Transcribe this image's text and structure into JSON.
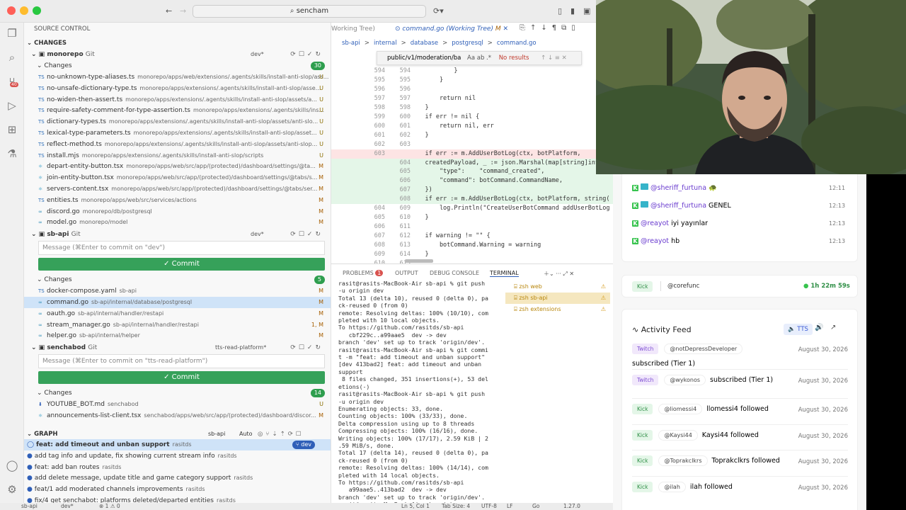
{
  "titlebar": {
    "search": "sencham"
  },
  "sidebar": {
    "header": "SOURCE CONTROL",
    "changes_title": "CHANGES",
    "repos": [
      {
        "name": "monorepo",
        "type": "Git",
        "branch": "dev*",
        "changes_label": "Changes",
        "count": "30",
        "files": [
          {
            "name": "no-unknown-type-aliases.ts",
            "path": "monorepo/apps/web/extensions/.agents/skills/install-anti-slop/ass...",
            "status": "U"
          },
          {
            "name": "no-unsafe-dictionary-type.ts",
            "path": "monorepo/apps/extensions/.agents/skills/install-anti-slop/asse...",
            "status": "U"
          },
          {
            "name": "no-widen-then-assert.ts",
            "path": "monorepo/apps/extensions/.agents/skills/install-anti-slop/assets/a...",
            "status": "U"
          },
          {
            "name": "require-safety-comment-for-type-assertion.ts",
            "path": "monorepo/apps/extensions/.agents/skills/ins...",
            "status": "U"
          },
          {
            "name": "dictionary-types.ts",
            "path": "monorepo/apps/extensions/.agents/skills/install-anti-slop/assets/anti-slo...",
            "status": "U"
          },
          {
            "name": "lexical-type-parameters.ts",
            "path": "monorepo/apps/extensions/.agents/skills/install-anti-slop/asset...",
            "status": "U"
          },
          {
            "name": "reflect-method.ts",
            "path": "monorepo/apps/extensions/.agents/skills/install-anti-slop/assets/anti-slop...",
            "status": "U"
          },
          {
            "name": "install.mjs",
            "path": "monorepo/apps/extensions/.agents/skills/install-anti-slop/scripts",
            "status": "U"
          },
          {
            "name": "depart-entity-button.tsx",
            "path": "monorepo/apps/web/src/app/(protected)/dashboard/settings/@ta...",
            "status": "M"
          },
          {
            "name": "join-entity-button.tsx",
            "path": "monorepo/apps/web/src/app/(protected)/dashboard/settings/@tabs/s...",
            "status": "M"
          },
          {
            "name": "servers-content.tsx",
            "path": "monorepo/apps/web/src/app/(protected)/dashboard/settings/@tabs/ser...",
            "status": "M"
          },
          {
            "name": "entities.ts",
            "path": "monorepo/apps/web/src/services/actions",
            "status": "M"
          },
          {
            "name": "discord.go",
            "path": "monorepo/db/postgresql",
            "status": "M"
          },
          {
            "name": "model.go",
            "path": "monorepo/model",
            "status": "M"
          }
        ]
      },
      {
        "name": "sb-api",
        "type": "Git",
        "branch": "dev*",
        "message_placeholder": "Message (⌘Enter to commit on \"dev\")",
        "commit_label": "✓ Commit",
        "changes_label": "Changes",
        "count": "5",
        "files": [
          {
            "name": "docker-compose.yaml",
            "path": "sb-api",
            "status": "M"
          },
          {
            "name": "command.go",
            "path": "sb-api/internal/database/postgresql",
            "status": "M"
          },
          {
            "name": "oauth.go",
            "path": "sb-api/internal/handler/restapi",
            "status": "M"
          },
          {
            "name": "stream_manager.go",
            "path": "sb-api/internal/handler/restapi",
            "status": "1, M"
          },
          {
            "name": "helper.go",
            "path": "sb-api/internal/helper",
            "status": "M"
          }
        ]
      },
      {
        "name": "senchabod",
        "type": "Git",
        "branch": "tts-read-platform*",
        "message_placeholder": "Message (⌘Enter to commit on \"tts-read-platform\")",
        "commit_label": "✓ Commit",
        "changes_label": "Changes",
        "count": "14",
        "files": [
          {
            "name": "YOUTUBE_BOT.md",
            "path": "senchabod",
            "status": "U"
          },
          {
            "name": "announcements-list-client.tsx",
            "path": "senchabod/apps/web/src/app/(protected)/dashboard/discor...",
            "status": "M"
          }
        ]
      }
    ],
    "graph": {
      "title": "GRAPH",
      "repo": "sb-api",
      "mode": "Auto",
      "branch_badge": "dev",
      "commits": [
        {
          "msg": "feat: add timeout and unban support",
          "author": "rasitds"
        },
        {
          "msg": "add tag info and update, fix showing current stream info",
          "author": "rasitds"
        },
        {
          "msg": "feat: add ban routes",
          "author": "rasitds"
        },
        {
          "msg": "add delete message, update title and game category support",
          "author": "rasitds"
        },
        {
          "msg": "feat/1 add moderated channels improvements",
          "author": "rasitds"
        },
        {
          "msg": "fix/4 get senchabot: platforms deleted/departed entities",
          "author": "rasitds"
        }
      ]
    }
  },
  "editor": {
    "tabs": [
      "Working Tree)",
      "command.go (Working Tree)",
      "M"
    ],
    "breadcrumb": [
      "sb-api",
      ">",
      "internal",
      ">",
      "database",
      ">",
      "postgresql",
      ">",
      "command.go"
    ],
    "find": {
      "query": "public/v1/moderation/ba",
      "result": "No results"
    },
    "lines": [
      {
        "o": "594",
        "n": "594",
        "t": "            }",
        "kind": ""
      },
      {
        "o": "595",
        "n": "595",
        "t": "        }",
        "kind": ""
      },
      {
        "o": "596",
        "n": "596",
        "t": "",
        "kind": ""
      },
      {
        "o": "597",
        "n": "597",
        "t": "        return nil",
        "kind": ""
      },
      {
        "o": "598",
        "n": "598",
        "t": "    }",
        "kind": ""
      },
      {
        "o": "599",
        "n": "600",
        "t": "    if err != nil {",
        "kind": ""
      },
      {
        "o": "600",
        "n": "601",
        "t": "        return nil, err",
        "kind": ""
      },
      {
        "o": "601",
        "n": "602",
        "t": "    }",
        "kind": ""
      },
      {
        "o": "602",
        "n": "603",
        "t": "",
        "kind": ""
      },
      {
        "o": "603",
        "n": "",
        "t": "    if err := m.AddUserBotLog(ctx, botPlatform, ",
        "kind": "del"
      },
      {
        "o": "",
        "n": "604",
        "t": "    createdPayload, _ := json.Marshal(map[string]inter",
        "kind": "add"
      },
      {
        "o": "",
        "n": "605",
        "t": "        \"type\":    \"command_created\",",
        "kind": "add"
      },
      {
        "o": "",
        "n": "606",
        "t": "        \"command\": botCommand.CommandName,",
        "kind": "add"
      },
      {
        "o": "",
        "n": "607",
        "t": "    })",
        "kind": "add"
      },
      {
        "o": "",
        "n": "608",
        "t": "    if err := m.AddUserBotLog(ctx, botPlatform, string(",
        "kind": "add"
      },
      {
        "o": "604",
        "n": "609",
        "t": "        log.Println(\"CreateUserBotCommand addUserBotLog",
        "kind": ""
      },
      {
        "o": "605",
        "n": "610",
        "t": "    }",
        "kind": ""
      },
      {
        "o": "606",
        "n": "611",
        "t": "",
        "kind": ""
      },
      {
        "o": "607",
        "n": "612",
        "t": "    if warning != \"\" {",
        "kind": ""
      },
      {
        "o": "608",
        "n": "613",
        "t": "        botCommand.Warning = warning",
        "kind": ""
      },
      {
        "o": "609",
        "n": "614",
        "t": "    }",
        "kind": ""
      },
      {
        "o": "610",
        "n": "615",
        "t": "",
        "kind": ""
      }
    ]
  },
  "panel": {
    "tabs": [
      "PROBLEMS",
      "OUTPUT",
      "DEBUG CONSOLE",
      "TERMINAL"
    ],
    "problems_count": "1",
    "terminal_text": "rasit@rasits-MacBook-Air sb-api % git push\n-u origin dev\nTotal 13 (delta 10), reused 0 (delta 0), pa\nck-reused 0 (from 0)\nremote: Resolving deltas: 100% (10/10), com\npleted with 10 local objects.\nTo https://github.com/rasitds/sb-api\n   cbf229c..a99aae5  dev -> dev\nbranch 'dev' set up to track 'origin/dev'.\nrasit@rasits-MacBook-Air sb-api % git commi\nt -m \"feat: add timeout and unban support\"\n[dev 413bad2] feat: add timeout and unban\nsupport\n 8 files changed, 351 insertions(+), 53 del\netions(-)\nrasit@rasits-MacBook-Air sb-api % git push\n-u origin dev\nEnumerating objects: 33, done.\nCounting objects: 100% (33/33), done.\nDelta compression using up to 8 threads\nCompressing objects: 100% (16/16), done.\nWriting objects: 100% (17/17), 2.59 KiB | 2\n.59 MiB/s, done.\nTotal 17 (delta 14), reused 0 (delta 0), pa\nck-reused 0 (from 0)\nremote: Resolving deltas: 100% (14/14), com\npleted with 14 local objects.\nTo https://github.com/rasitds/sb-api\n   a99aae5..413bad2  dev -> dev\nbranch 'dev' set up to track 'origin/dev'.\nrasit@rasits-MacBook-Air sb-api % ▯",
    "shells": [
      "zsh web",
      "zsh sb-api",
      "zsh extensions"
    ]
  },
  "statusbar": {
    "repo": "sb-api",
    "branch": "dev*",
    "problems": "⊗ 1 ⚠ 0",
    "position": "Ln 5, Col 1",
    "tab": "Tab Size: 4",
    "enc": "UTF-8",
    "eol": "LF",
    "lang": "Go",
    "ver": "1.27.0"
  },
  "dashboard": {
    "chat": [
      {
        "user": "@sheriff_furtuna",
        "msg": "🐢",
        "time": "12:11"
      },
      {
        "user": "@sheriff_furtuna",
        "msg": "GENEL",
        "time": "12:13"
      },
      {
        "user": "@reayot",
        "msg": "iyi yayınlar",
        "time": "12:13"
      },
      {
        "user": "@reayot",
        "msg": "hb",
        "time": "12:13"
      }
    ],
    "stream": {
      "platform": "Kick",
      "channel": "@corefunc",
      "uptime": "1h 22m 59s"
    },
    "feed": {
      "title": "Activity Feed",
      "tts": "TTS",
      "events": [
        {
          "platform": "Twitch",
          "user": "@notDepressDeveloper",
          "text": "subscribed (Tier 1)",
          "date": "August 30, 2026"
        },
        {
          "platform": "Twitch",
          "user": "@wykonos",
          "text": "subscribed (Tier 1)",
          "date": "August 30, 2026"
        },
        {
          "platform": "Kick",
          "user": "@liomessi4",
          "text": "llomessi4 followed",
          "date": "August 30, 2026"
        },
        {
          "platform": "Kick",
          "user": "@Kaysi44",
          "text": "Kaysi44 followed",
          "date": "August 30, 2026"
        },
        {
          "platform": "Kick",
          "user": "@Toprakclkrs",
          "text": "Toprakclkrs followed",
          "date": "August 30, 2026"
        },
        {
          "platform": "Kick",
          "user": "@ilah",
          "text": "ilah followed",
          "date": "August 30, 2026"
        }
      ]
    }
  },
  "colors": {
    "accent": "#36a15a",
    "kick": "#37c34e",
    "twitch": "#7c4bd3",
    "del_bg": "#fde4e4",
    "add_bg": "#e4f6e8"
  }
}
